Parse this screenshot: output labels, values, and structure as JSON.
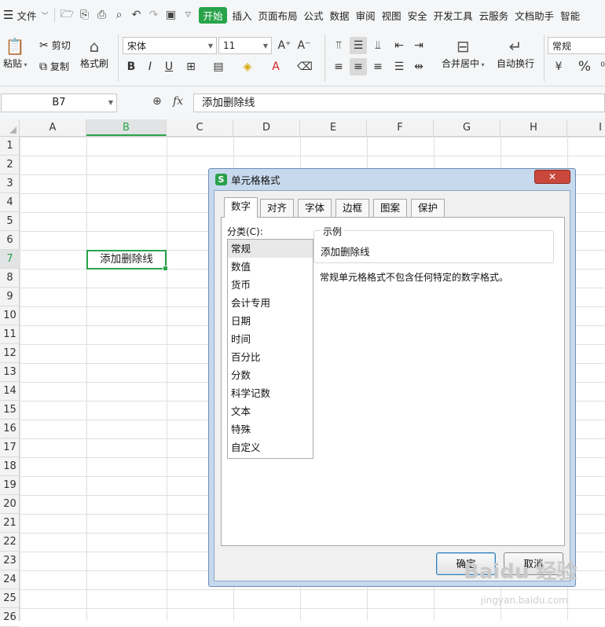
{
  "menubar": {
    "file_label": "文件",
    "tabs": [
      {
        "label": "开始",
        "active": true
      },
      {
        "label": "插入"
      },
      {
        "label": "页面布局"
      },
      {
        "label": "公式"
      },
      {
        "label": "数据"
      },
      {
        "label": "审阅"
      },
      {
        "label": "视图"
      },
      {
        "label": "安全"
      },
      {
        "label": "开发工具"
      },
      {
        "label": "云服务"
      },
      {
        "label": "文档助手"
      },
      {
        "label": "智能"
      }
    ]
  },
  "toolbar": {
    "paste_label": "粘贴",
    "cut_label": "剪切",
    "copy_label": "复制",
    "format_painter_label": "格式刷",
    "font_name": "宋体",
    "font_size": "11",
    "merge_label": "合并居中",
    "wrap_label": "自动换行",
    "number_format": "常规"
  },
  "formula_bar": {
    "name_box": "B7",
    "fx": "fx",
    "content": "添加删除线"
  },
  "sheet": {
    "columns": [
      "A",
      "B",
      "C",
      "D",
      "E",
      "F",
      "G",
      "H",
      "I"
    ],
    "selected_column": "B",
    "rows": [
      "1",
      "2",
      "3",
      "4",
      "5",
      "6",
      "7",
      "8",
      "9",
      "10",
      "11",
      "12",
      "13",
      "14",
      "15",
      "16",
      "17",
      "18",
      "19",
      "20",
      "21",
      "22",
      "23",
      "24",
      "25",
      "26"
    ],
    "selected_row": "7",
    "cell_B7": "添加删除线"
  },
  "dialog": {
    "title": "单元格格式",
    "close_label": "✕",
    "tabs": [
      "数字",
      "对齐",
      "字体",
      "边框",
      "图案",
      "保护"
    ],
    "active_tab": "数字",
    "category_label": "分类(C):",
    "categories": [
      "常规",
      "数值",
      "货币",
      "会计专用",
      "日期",
      "时间",
      "百分比",
      "分数",
      "科学记数",
      "文本",
      "特殊",
      "自定义"
    ],
    "selected_category": "常规",
    "sample_legend": "示例",
    "sample_text": "添加删除线",
    "description": "常规单元格格式不包含任何特定的数字格式。",
    "ok_label": "确定",
    "cancel_label": "取消"
  },
  "watermark": {
    "text": "Baidu 经验",
    "sub": "jingyan.baidu.com"
  },
  "colors": {
    "accent": "#29a34a",
    "dialog_frame": "#c7d9ed",
    "close_button": "#c9483b"
  }
}
